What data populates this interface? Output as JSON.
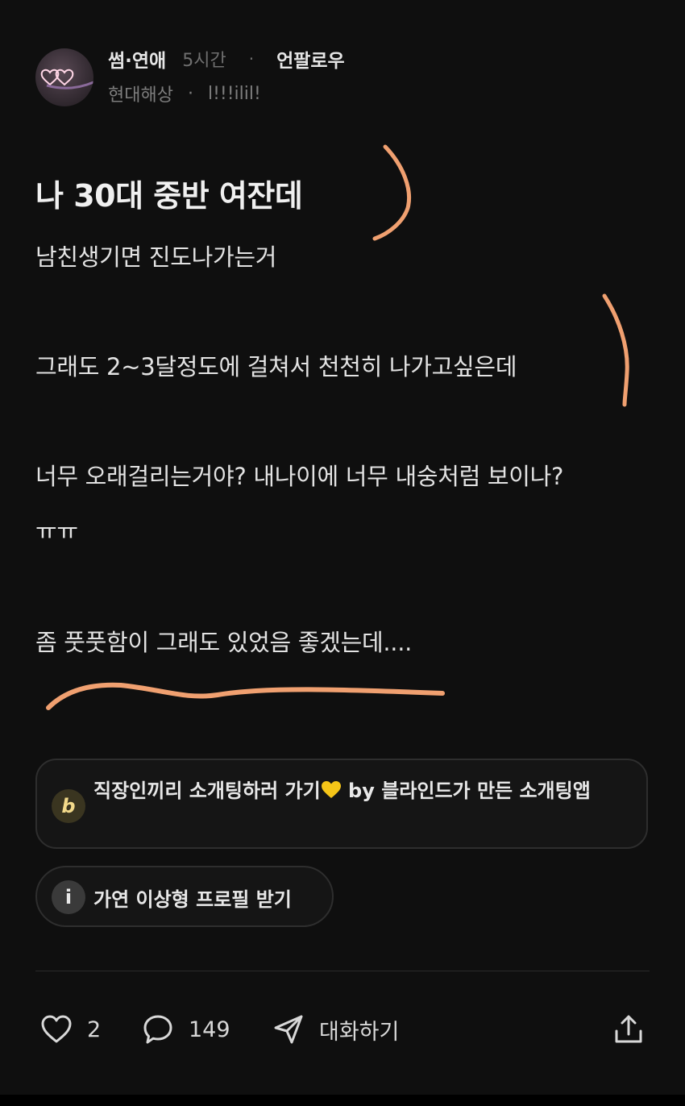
{
  "header": {
    "category": "썸·연애",
    "time": "5시간",
    "separator": "·",
    "unfollow": "언팔로우",
    "company": "현대해상",
    "separator2": "·",
    "nickname": "l!!!ilil!"
  },
  "post": {
    "title": "나 30대 중반 여잔데",
    "lines": [
      "남친생기면 진도나가는거",
      "그래도 2~3달정도에 걸쳐서 천천히 나가고싶은데",
      "너무 오래걸리는거야? 내나이에 너무 내숭처럼 보이나?",
      "ㅠㅠ",
      "좀 풋풋함이 그래도 있었음 좋겠는데...."
    ]
  },
  "ad": {
    "logo": "b",
    "text_before": "직장인끼리 소개팅하러 가기",
    "text_after": " by 블라인드가 만든 소개팅앱",
    "icon": "yellow-heart-icon"
  },
  "info_chip": {
    "icon": "i",
    "label": "가연 이상형 프로필 받기"
  },
  "actions": {
    "likes": "2",
    "comments": "149",
    "chat_label": "대화하기"
  },
  "colors": {
    "background": "#0f0f0f",
    "text": "#e3e3e3",
    "muted": "#6f6f6f",
    "scribble": "#f0a070",
    "yellow_heart": "#f5c518"
  }
}
